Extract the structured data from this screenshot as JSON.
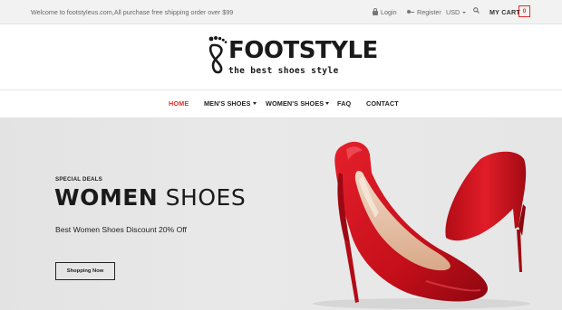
{
  "topbar": {
    "welcome": "Welcome to footstyleus.com,All purchase free shipping order over $99",
    "login": "Login",
    "register": "Register",
    "currency": "USD",
    "my_cart": "MY CART",
    "cart_count": "0"
  },
  "brand": {
    "name": "FOOTSTYLE",
    "tagline": "the best shoes style"
  },
  "nav": {
    "items": [
      {
        "label": "HOME",
        "active": true
      },
      {
        "label": "MEN'S SHOES",
        "dropdown": true
      },
      {
        "label": "WOMEN'S SHOES",
        "dropdown": true
      },
      {
        "label": "FAQ"
      },
      {
        "label": "CONTACT"
      }
    ]
  },
  "hero": {
    "kicker": "SPECIAL DEALS",
    "title_bold": "WOMEN",
    "title_light": "SHOES",
    "subtitle": "Best Women Shoes Discount 20% Off",
    "button": "Shopping Now",
    "image": "red-high-heel-shoes"
  },
  "colors": {
    "accent": "#e52d2d",
    "topbar_bg": "#f2f2f2",
    "hero_bg": "#e6e6e6",
    "shoe_red": "#d1131f"
  },
  "icons": [
    "lock-icon",
    "user-plus-icon",
    "search-icon",
    "footprint-logo-icon"
  ]
}
